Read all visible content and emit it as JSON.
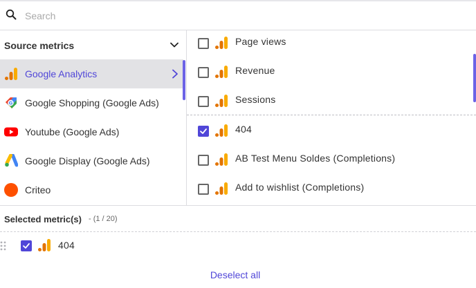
{
  "search": {
    "placeholder": "Search",
    "value": ""
  },
  "source": {
    "title": "Source metrics",
    "items": [
      {
        "label": "Google Analytics",
        "icon": "google-analytics-icon",
        "active": true
      },
      {
        "label": "Google Shopping (Google Ads)",
        "icon": "google-shopping-icon",
        "active": false
      },
      {
        "label": "Youtube (Google Ads)",
        "icon": "youtube-icon",
        "active": false
      },
      {
        "label": "Google Display (Google Ads)",
        "icon": "google-ads-icon",
        "active": false
      },
      {
        "label": "Criteo",
        "icon": "criteo-icon",
        "active": false
      }
    ]
  },
  "metrics": {
    "items": [
      {
        "label": "Page views",
        "checked": false
      },
      {
        "label": "Revenue",
        "checked": false
      },
      {
        "label": "Sessions",
        "checked": false
      },
      {
        "label": "404",
        "checked": true
      },
      {
        "label": "AB Test Menu Soldes (Completions)",
        "checked": false
      },
      {
        "label": "Add to wishlist (Completions)",
        "checked": false
      }
    ]
  },
  "selected": {
    "title": "Selected metric(s)",
    "count": "- (1 / 20)",
    "items": [
      {
        "label": "404",
        "checked": true
      }
    ],
    "deselect_label": "Deselect all"
  },
  "colors": {
    "accent": "#5046d8",
    "active_bg": "#e2e2e5",
    "ga_orange": "#f9ab00",
    "ga_dark_orange": "#e37400",
    "youtube_red": "#ff0000",
    "criteo_orange": "#fe5000"
  }
}
